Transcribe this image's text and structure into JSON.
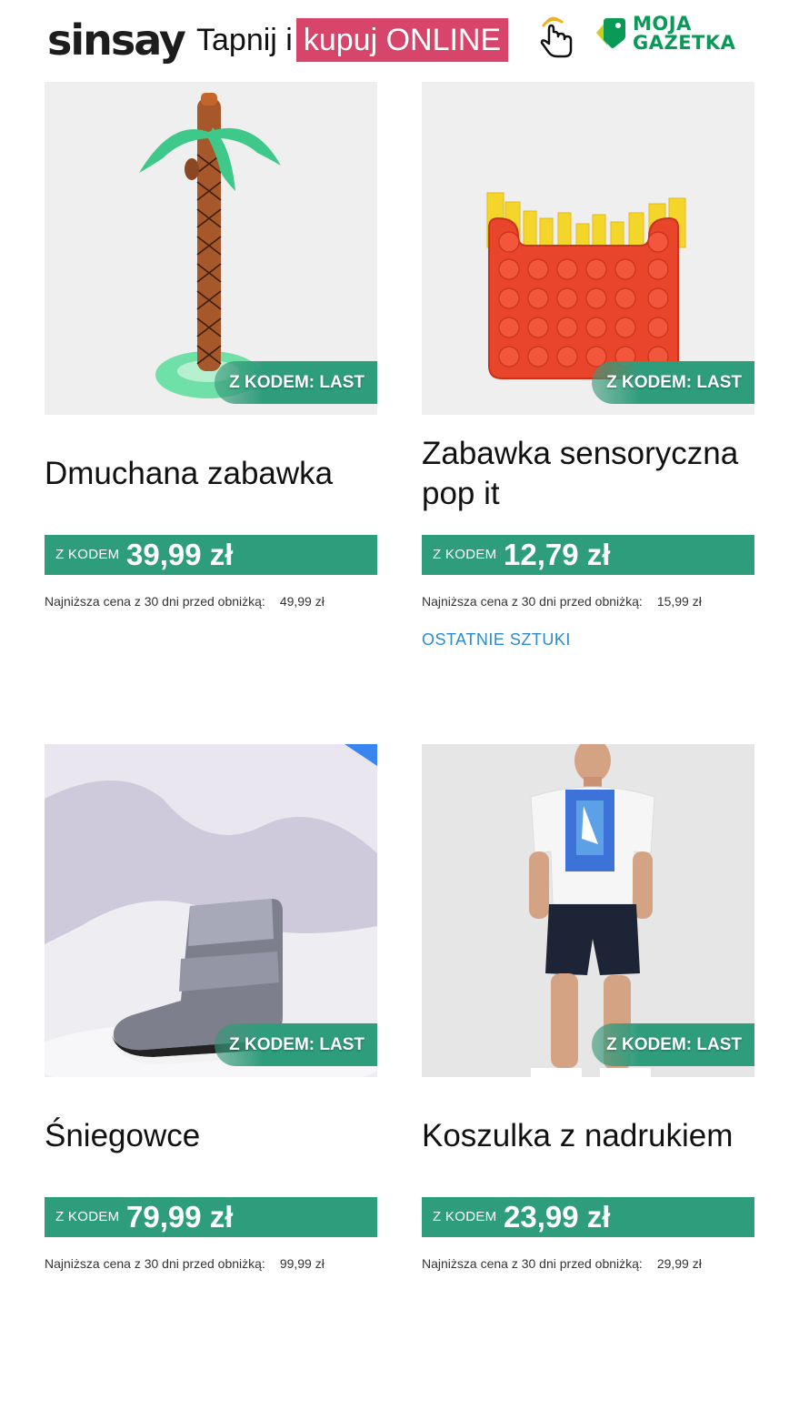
{
  "header": {
    "logo_text": "sinsay",
    "tagline_plain": "Tapnij i",
    "tagline_highlight": "kupuj ONLINE",
    "gazetka_line1": "MOJA",
    "gazetka_line2": "GAZETKA",
    "hand_icon": "tap-hand-icon"
  },
  "colors": {
    "accent_green": "#2e9d7c",
    "highlight_pink": "#d7456a",
    "gazetka_green": "#0a9a57",
    "stock_blue": "#2a8bd0"
  },
  "products": [
    {
      "badge": "Z KODEM: LAST",
      "title": "Dmuchana zabawka",
      "price_label": "Z KODEM",
      "price": "39,99 zł",
      "lowest_label": "Najniższa cena z 30 dni przed obniżką:",
      "lowest_value": "49,99 zł",
      "stock_note": ""
    },
    {
      "badge": "Z KODEM: LAST",
      "title": "Zabawka sensoryczna pop it",
      "price_label": "Z KODEM",
      "price": "12,79 zł",
      "lowest_label": "Najniższa cena z 30 dni przed obniżką:",
      "lowest_value": "15,99 zł",
      "stock_note": "OSTATNIE SZTUKI"
    },
    {
      "badge": "Z KODEM: LAST",
      "title": "Śniegowce",
      "price_label": "Z KODEM",
      "price": "79,99 zł",
      "lowest_label": "Najniższa cena z 30 dni przed obniżką:",
      "lowest_value": "99,99 zł",
      "stock_note": ""
    },
    {
      "badge": "Z KODEM: LAST",
      "title": "Koszulka z nadrukiem",
      "price_label": "Z KODEM",
      "price": "23,99 zł",
      "lowest_label": "Najniższa cena z 30 dni przed obniżką:",
      "lowest_value": "29,99 zł",
      "stock_note": ""
    }
  ]
}
